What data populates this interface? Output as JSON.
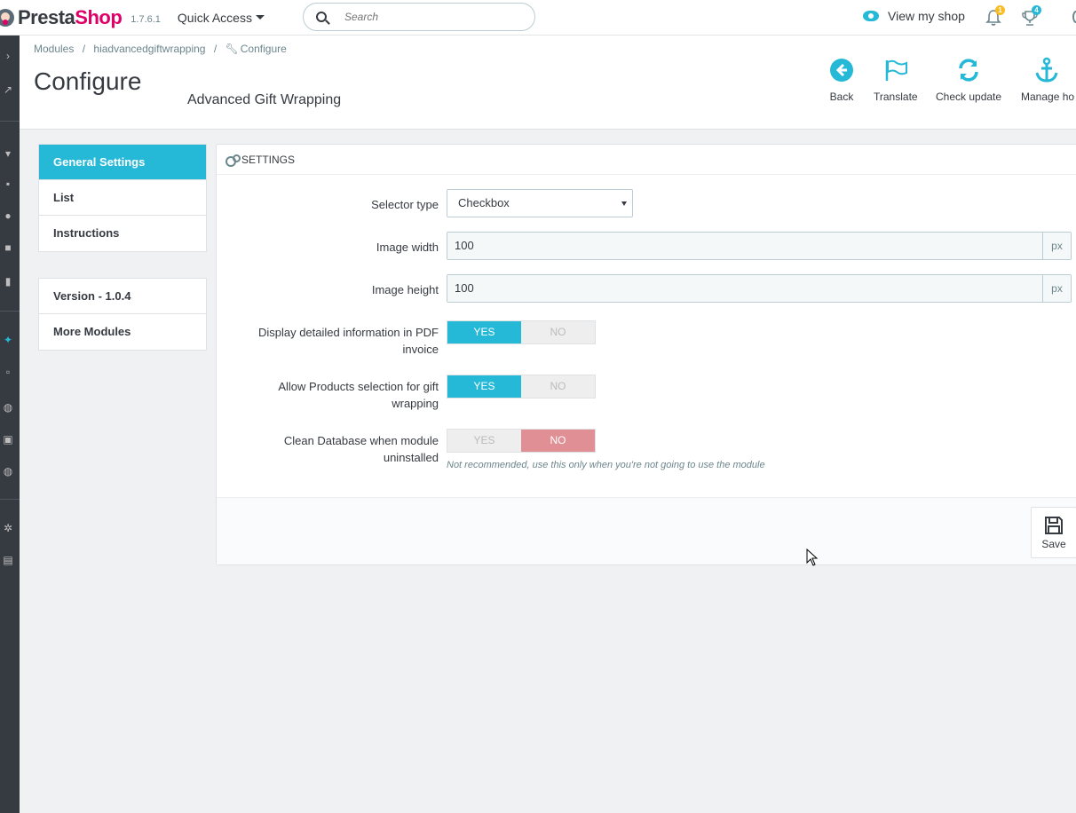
{
  "header": {
    "logo_part1": "Presta",
    "logo_part2": "Shop",
    "version": "1.7.6.1",
    "quick_access": "Quick Access",
    "search_placeholder": "Search",
    "view_shop": "View my shop",
    "notifications_count": "1",
    "trophy_count": "4"
  },
  "breadcrumb": {
    "item1": "Modules",
    "sep": "/",
    "item2": "hiadvancedgiftwrapping",
    "item3": "Configure"
  },
  "page": {
    "title": "Configure",
    "subtitle": "Advanced Gift Wrapping"
  },
  "toolbar": {
    "back": "Back",
    "translate": "Translate",
    "check_update": "Check update",
    "manage_hooks": "Manage ho"
  },
  "tabs": {
    "general": "General Settings",
    "list": "List",
    "instructions": "Instructions"
  },
  "info": {
    "version": "Version - 1.0.4",
    "more_modules": "More Modules"
  },
  "settings": {
    "panel_title": "Settings",
    "selector_type_label": "Selector type",
    "selector_type_value": "Checkbox",
    "image_width_label": "Image width",
    "image_width_value": "100",
    "image_height_label": "Image height",
    "image_height_value": "100",
    "unit": "px",
    "pdf_label_line1": "Display detailed information in PDF",
    "pdf_label_line2": "invoice",
    "products_label_line1": "Allow Products selection for gift",
    "products_label_line2": "wrapping",
    "clean_label_line1": "Clean Database when module",
    "clean_label_line2": "uninstalled",
    "yes": "YES",
    "no": "NO",
    "clean_help": "Not recommended, use this only when you're not going to use the module",
    "save": "Save"
  },
  "colors": {
    "brand_pink": "#df0067",
    "accent_blue": "#25b9d7",
    "danger_pink": "#e08f95"
  }
}
